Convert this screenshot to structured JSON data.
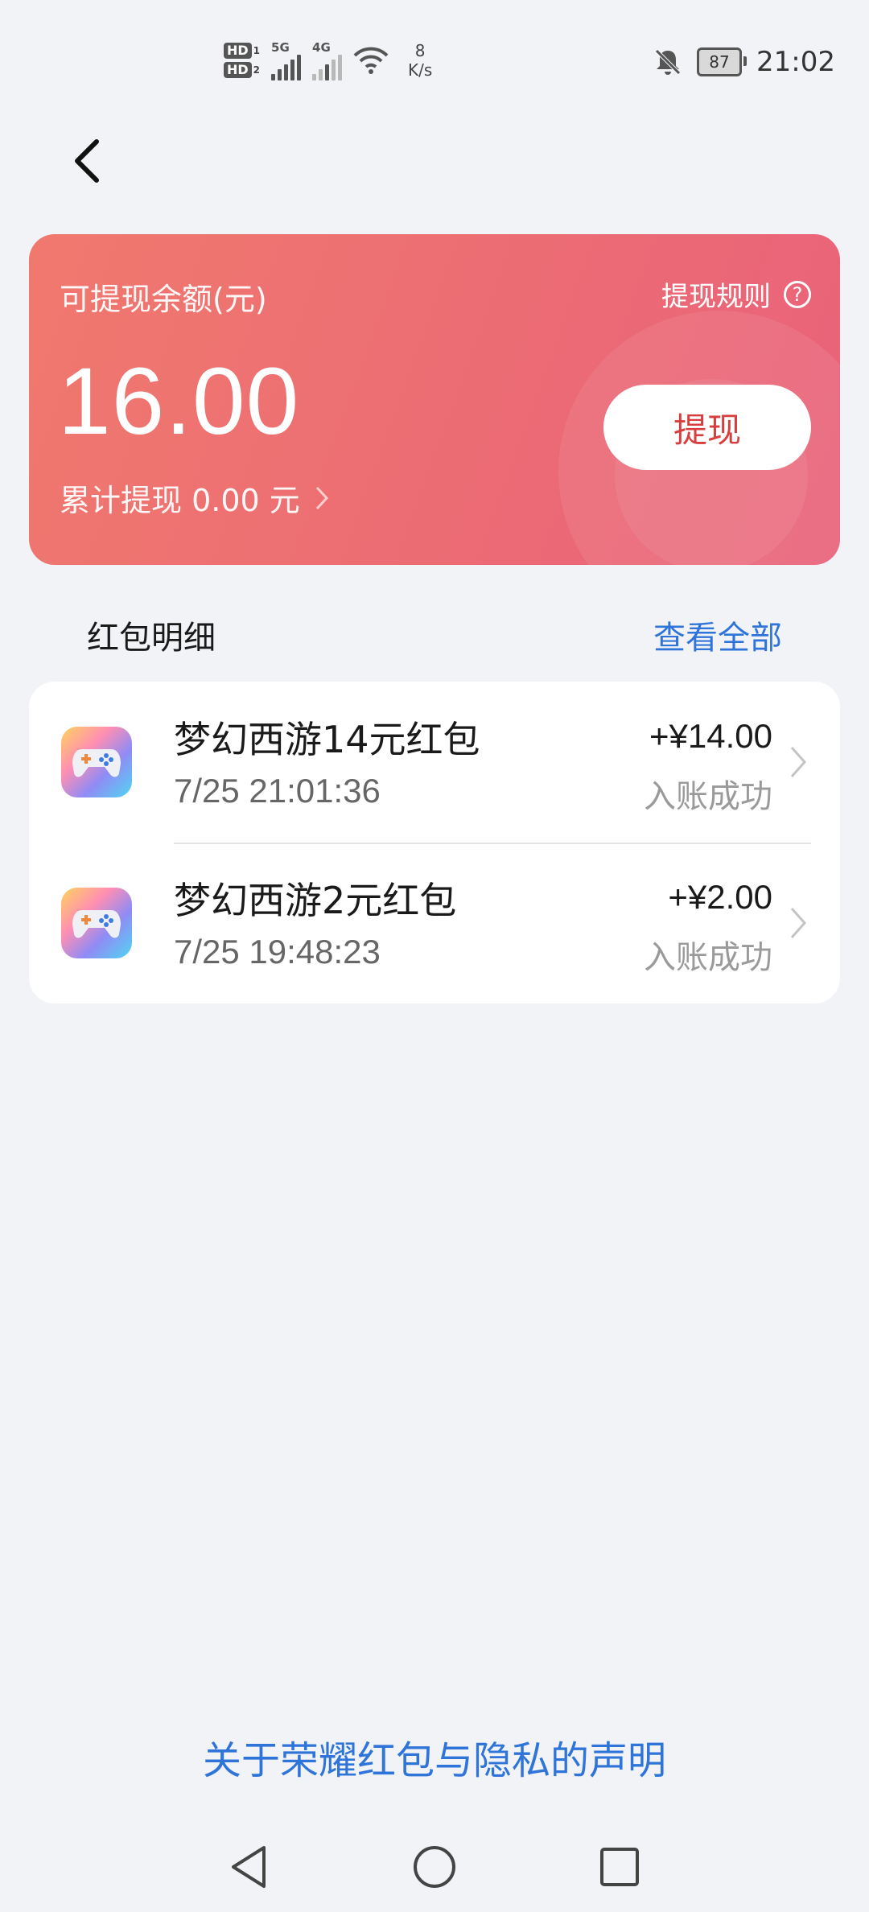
{
  "status_bar": {
    "hd1": "HD",
    "hd1_sub": "1",
    "hd2": "HD",
    "hd2_sub": "2",
    "net1": "5G",
    "net2": "4G",
    "speed_value": "8",
    "speed_unit": "K/s",
    "battery": "87",
    "time": "21:02",
    "icons": [
      "signal-icon",
      "wifi-icon",
      "bell-off-icon",
      "battery-icon"
    ]
  },
  "card": {
    "label": "可提现余额(元)",
    "rules_label": "提现规则",
    "rules_icon": "?",
    "amount": "16.00",
    "total_label": "累计提现 0.00 元",
    "withdraw_button": "提现",
    "colors": {
      "gradient_start": "#f0796e",
      "gradient_end": "#e9627a",
      "button_text": "#d83e3e"
    }
  },
  "section": {
    "title": "红包明细",
    "view_all": "查看全部"
  },
  "records": [
    {
      "title": "梦幻西游14元红包",
      "time": "7/25 21:01:36",
      "amount": "+¥14.00",
      "status": "入账成功",
      "icon": "game-controller-icon"
    },
    {
      "title": "梦幻西游2元红包",
      "time": "7/25 19:48:23",
      "amount": "+¥2.00",
      "status": "入账成功",
      "icon": "game-controller-icon"
    }
  ],
  "footer": {
    "privacy_link": "关于荣耀红包与隐私的声明"
  },
  "nav": {
    "buttons": [
      "back-triangle-icon",
      "home-circle-icon",
      "recent-square-icon"
    ]
  },
  "accent_color": "#2f74d9"
}
